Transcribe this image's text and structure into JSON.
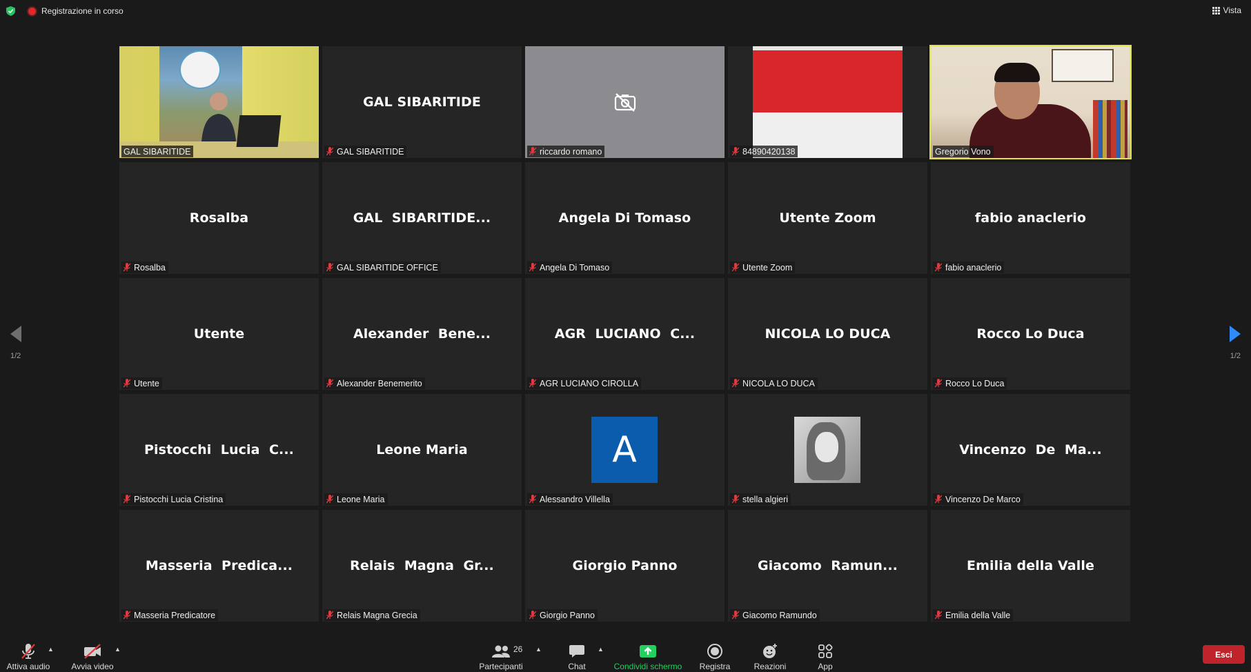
{
  "topbar": {
    "recording_label": "Registrazione in corso",
    "view_label": "Vista"
  },
  "pagination": {
    "left": "1/2",
    "right": "1/2"
  },
  "tiles": [
    {
      "big": "",
      "label": "GAL SIBARITIDE",
      "muted": false
    },
    {
      "big": "GAL SIBARITIDE",
      "label": "GAL SIBARITIDE",
      "muted": true
    },
    {
      "big": "",
      "label": "riccardo romano",
      "muted": true
    },
    {
      "big": "",
      "label": "84890420138",
      "muted": true
    },
    {
      "big": "",
      "label": "Gregorio Vono",
      "muted": false
    },
    {
      "big": "Rosalba",
      "label": "Rosalba",
      "muted": true
    },
    {
      "big": "GAL  SIBARITIDE...",
      "label": "GAL SIBARITIDE OFFICE",
      "muted": true
    },
    {
      "big": "Angela Di Tomaso",
      "label": "Angela Di Tomaso",
      "muted": true
    },
    {
      "big": "Utente Zoom",
      "label": "Utente Zoom",
      "muted": true
    },
    {
      "big": "fabio anaclerio",
      "label": "fabio anaclerio",
      "muted": true
    },
    {
      "big": "Utente",
      "label": "Utente",
      "muted": true
    },
    {
      "big": "Alexander  Bene...",
      "label": "Alexander Benemerito",
      "muted": true
    },
    {
      "big": "AGR  LUCIANO  C...",
      "label": "AGR LUCIANO CIROLLA",
      "muted": true
    },
    {
      "big": "NICOLA LO DUCA",
      "label": "NICOLA LO DUCA",
      "muted": true
    },
    {
      "big": "Rocco Lo Duca",
      "label": "Rocco Lo Duca",
      "muted": true
    },
    {
      "big": "Pistocchi  Lucia  C...",
      "label": "Pistocchi Lucia Cristina",
      "muted": true
    },
    {
      "big": "Leone Maria",
      "label": "Leone Maria",
      "muted": true
    },
    {
      "big": "",
      "label": "Alessandro Villella",
      "muted": true,
      "avatar_letter": "A"
    },
    {
      "big": "",
      "label": "stella algieri",
      "muted": true
    },
    {
      "big": "Vincenzo  De  Ma...",
      "label": "Vincenzo De Marco",
      "muted": true
    },
    {
      "big": "Masseria  Predica...",
      "label": "Masseria Predicatore",
      "muted": true
    },
    {
      "big": "Relais  Magna  Gr...",
      "label": "Relais Magna Grecia",
      "muted": true
    },
    {
      "big": "Giorgio Panno",
      "label": "Giorgio Panno",
      "muted": true
    },
    {
      "big": "Giacomo  Ramun...",
      "label": "Giacomo Ramundo",
      "muted": true
    },
    {
      "big": "Emilia della Valle",
      "label": "Emilia della Valle",
      "muted": true
    }
  ],
  "toolbar": {
    "audio": "Attiva audio",
    "video": "Avvia video",
    "participants": "Partecipanti",
    "participants_count": "26",
    "chat": "Chat",
    "share": "Condividi schermo",
    "record": "Registra",
    "reactions": "Reazioni",
    "apps": "App",
    "leave": "Esci"
  },
  "colors": {
    "background": "#1a1a1a",
    "tile": "#252525",
    "active_speaker": "#dde14a",
    "muted_icon": "#e0393e",
    "share_green": "#23d160",
    "leave_red": "#c0242a",
    "arrow_active": "#2d8cff"
  }
}
